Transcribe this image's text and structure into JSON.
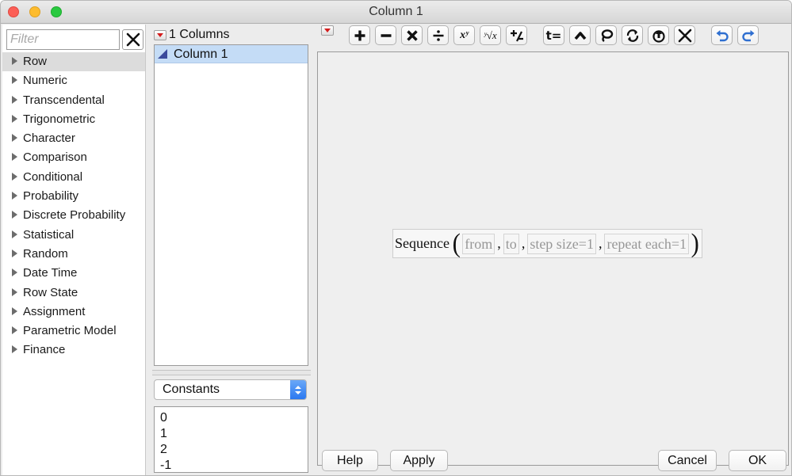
{
  "window": {
    "title": "Column 1"
  },
  "filter": {
    "placeholder": "Filter",
    "value": ""
  },
  "categories": [
    "Row",
    "Numeric",
    "Transcendental",
    "Trigonometric",
    "Character",
    "Comparison",
    "Conditional",
    "Probability",
    "Discrete Probability",
    "Statistical",
    "Random",
    "Date Time",
    "Row State",
    "Assignment",
    "Parametric Model",
    "Finance"
  ],
  "selected_category": "Row",
  "columns": {
    "header": "1 Columns",
    "items": [
      "Column 1"
    ]
  },
  "constants": {
    "selected": "Constants",
    "values": [
      "0",
      "1",
      "2",
      "-1"
    ]
  },
  "toolbar": {
    "icons": [
      "plus-icon",
      "minus-icon",
      "multiply-icon",
      "divide-icon",
      "power-icon",
      "root-icon",
      "negate-icon",
      "local-variable-icon",
      "peel-icon",
      "lasso-icon",
      "swap-icon",
      "unthrow-icon",
      "delete-icon",
      "undo-icon",
      "redo-icon"
    ],
    "power_label": "xʸ",
    "root_label": "ʸ√x",
    "local_label": "t="
  },
  "formula": {
    "function": "Sequence",
    "args": [
      "from",
      "to",
      "step size=1",
      "repeat each=1"
    ]
  },
  "buttons": {
    "help": "Help",
    "apply": "Apply",
    "cancel": "Cancel",
    "ok": "OK"
  }
}
